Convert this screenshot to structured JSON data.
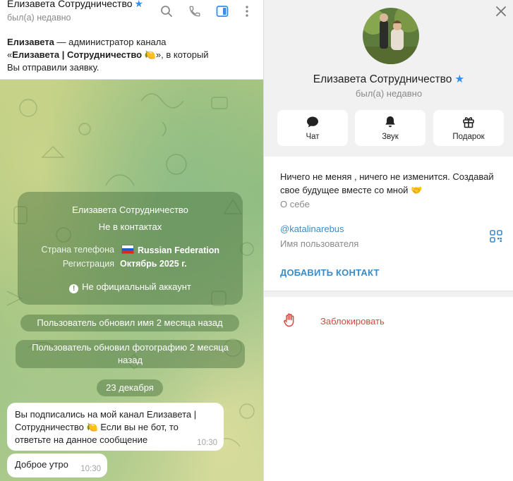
{
  "chat_header": {
    "title": "Елизавета Сотрудничество",
    "status": "был(а) недавно",
    "icons": [
      "search-icon",
      "phone-icon",
      "sidebar-toggle-icon",
      "more-vertical-icon"
    ]
  },
  "notice": {
    "line1_name": "Елизавета",
    "line1_rest": " — администратор канала",
    "line2_open": "«",
    "line2_channel": "Елизавета | Сотрудничество 🍋",
    "line2_rest": "», в который",
    "line3": "Вы отправили заявку."
  },
  "info_card": {
    "name": "Елизавета Сотрудничество",
    "contact_status": "Не в контактах",
    "phone_country_label": "Страна телефона",
    "phone_country_value": "Russian Federation",
    "registration_label": "Регистрация",
    "registration_value": "Октябрь 2025 г.",
    "unofficial": "Не официальный аккаунт"
  },
  "service_messages": {
    "name_update": "Пользователь обновил имя 2 месяца назад",
    "photo_update_line1": "Пользователь обновил фотографию 2 месяца",
    "photo_update_line2": "назад",
    "date": "23 декабря"
  },
  "messages": [
    {
      "line1": "Вы подписались на мой канал Елизавета |",
      "line2_a": "Сотрудничество ",
      "line2_b": " Если вы не бот, то",
      "line3": "ответьте на данное сообщение",
      "time": "10:30"
    },
    {
      "text": "Доброе утро",
      "time": "10:30"
    }
  ],
  "profile": {
    "name": "Елизавета Сотрудничество",
    "status": "был(а) недавно",
    "actions": [
      {
        "label": "Чат",
        "icon": "chat-bubble-icon"
      },
      {
        "label": "Звук",
        "icon": "bell-icon"
      },
      {
        "label": "Подарок",
        "icon": "gift-icon"
      }
    ],
    "bio": "Ничего не меняя , ничего не изменится. Создавай свое будущее вместе со мной 🤝",
    "bio_label": "О себе",
    "username": "@katalinarebus",
    "username_label": "Имя пользователя",
    "add_contact": "ДОБАВИТЬ КОНТАКТ",
    "block": "Заблокировать"
  },
  "colors": {
    "accent": "#3390ec",
    "link": "#3a8bc8",
    "danger": "#d14a3e",
    "bubble": "#ffffff"
  }
}
